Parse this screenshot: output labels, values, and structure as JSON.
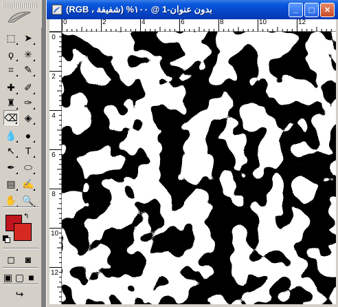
{
  "toolbox": {
    "tools": [
      {
        "name": "marquee-tool",
        "glyph": "⬚"
      },
      {
        "name": "move-tool",
        "glyph": "➤"
      },
      {
        "name": "lasso-tool",
        "glyph": "ϙ"
      },
      {
        "name": "magic-wand-tool",
        "glyph": "✳"
      },
      {
        "name": "crop-tool",
        "glyph": "⌗"
      },
      {
        "name": "slice-tool",
        "glyph": "✎"
      },
      {
        "name": "healing-brush-tool",
        "glyph": "✚"
      },
      {
        "name": "brush-tool",
        "glyph": "✐"
      },
      {
        "name": "clone-stamp-tool",
        "glyph": "♜"
      },
      {
        "name": "history-brush-tool",
        "glyph": "✑"
      },
      {
        "name": "eraser-tool",
        "glyph": "⌫"
      },
      {
        "name": "paint-bucket-tool",
        "glyph": "◈"
      },
      {
        "name": "blur-tool",
        "glyph": "💧"
      },
      {
        "name": "dodge-tool",
        "glyph": "●"
      },
      {
        "name": "path-selection-tool",
        "glyph": "↖"
      },
      {
        "name": "type-tool",
        "glyph": "T"
      },
      {
        "name": "pen-tool",
        "glyph": "✒"
      },
      {
        "name": "ellipse-tool",
        "glyph": "⬭"
      },
      {
        "name": "notes-tool",
        "glyph": "▤"
      },
      {
        "name": "eyedropper-tool",
        "glyph": "✍"
      },
      {
        "name": "hand-tool",
        "glyph": "✋"
      },
      {
        "name": "zoom-tool",
        "glyph": "🔍"
      },
      {
        "name": "standard-mode-button",
        "glyph": "◻"
      },
      {
        "name": "quick-mask-mode-button",
        "glyph": "◙"
      },
      {
        "name": "screen-mode-standard-button",
        "glyph": "▣"
      },
      {
        "name": "screen-mode-full-menu-button",
        "glyph": "▢"
      },
      {
        "name": "screen-mode-full-button",
        "glyph": "■"
      },
      {
        "name": "jump-to-imageready-button",
        "glyph": "↪"
      }
    ],
    "foreground_color": "#c0141e",
    "background_color": "#d42a22",
    "swap_glyph": "↰",
    "active_tool": "eraser-tool"
  },
  "document": {
    "title": "بدون عنوان-1 @ ١٠٠% (شفيفة ، RGB)",
    "minimize_glyph": "_",
    "maximize_glyph": "□",
    "close_glyph": "✕",
    "hruler_labels": [
      "0",
      "2",
      "4",
      "6",
      "8",
      "10",
      "12"
    ],
    "vruler_labels": [
      "0",
      "2",
      "4",
      "6",
      "8",
      "10",
      "12"
    ],
    "title_bar_color": "#0a5ae0",
    "canvas_colors": [
      "#000000",
      "#ffffff"
    ]
  }
}
